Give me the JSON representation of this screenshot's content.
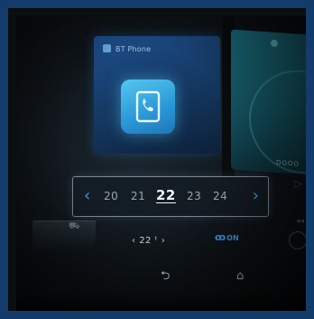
{
  "tiles": {
    "bt_phone": {
      "title": "BT Phone",
      "accent": "#2a97d6"
    },
    "radio": {
      "footer_text": "DOOO"
    }
  },
  "date_selector": {
    "prev_icon": "chevron-left-icon",
    "next_icon": "chevron-right-icon",
    "days": [
      "20",
      "21",
      "22",
      "23",
      "24"
    ],
    "selected_index": 2,
    "accent": "#3fa0e8"
  },
  "climate": {
    "temp_left": "‹",
    "temp_value": "22",
    "temp_unit": "ᵗ",
    "temp_right": "›",
    "fan_icon": "fan-icon",
    "fan_glyph": "ꞵ",
    "fan_state": "ON",
    "fan_color": "#3c9ef0"
  },
  "nav": {
    "back_icon": "back-icon",
    "home_icon": "home-icon"
  }
}
